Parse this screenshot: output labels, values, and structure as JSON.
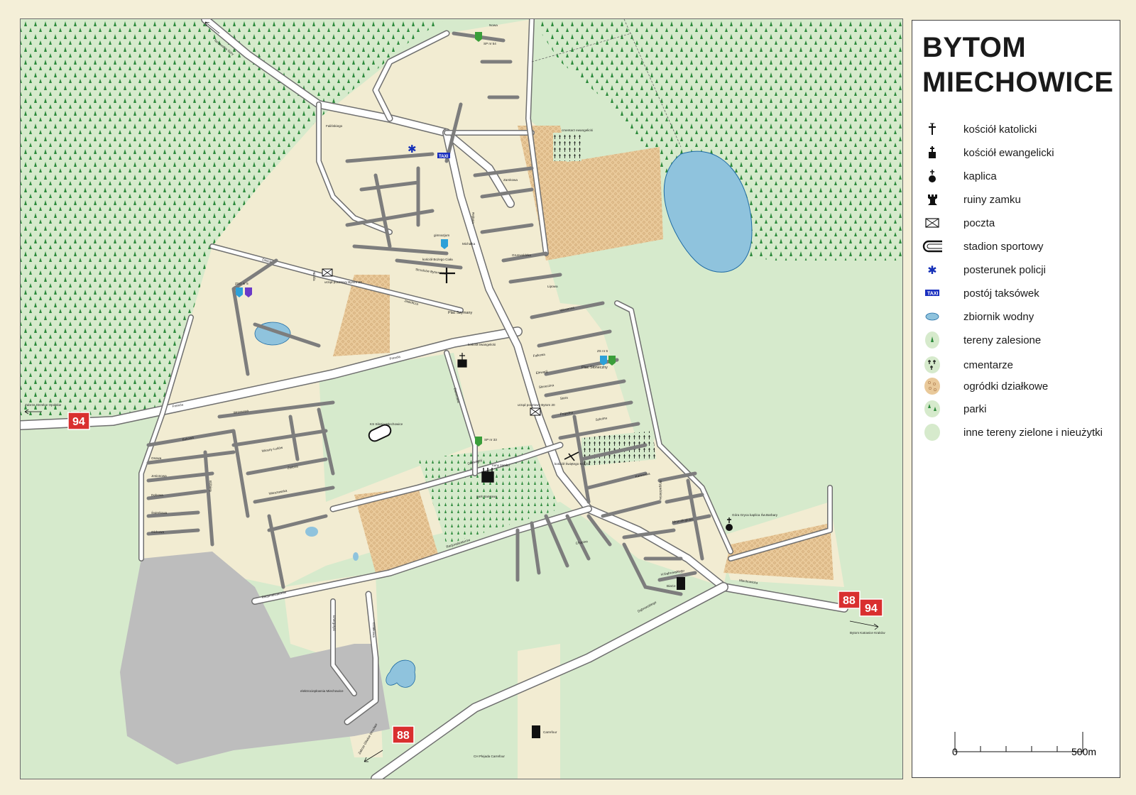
{
  "legend": {
    "title_line1": "BYTOM",
    "title_line2": "MIECHOWICE",
    "items": [
      {
        "label": "kościół katolicki",
        "icon": "latin-cross-icon"
      },
      {
        "label": "kościół ewangelicki",
        "icon": "evangelical-church-icon"
      },
      {
        "label": "kaplica",
        "icon": "chapel-icon"
      },
      {
        "label": "ruiny zamku",
        "icon": "castle-ruin-icon"
      },
      {
        "label": "poczta",
        "icon": "envelope-icon"
      },
      {
        "label": "stadion sportowy",
        "icon": "stadium-icon"
      },
      {
        "label": "posterunek policji",
        "icon": "police-star-icon"
      },
      {
        "label": "postój taksówek",
        "icon": "taxi-icon"
      },
      {
        "label": "zbiornik wodny",
        "icon": "water-body-icon"
      },
      {
        "label": "tereny zalesione",
        "icon": "forest-icon"
      },
      {
        "label": "cmentarze",
        "icon": "cemetery-icon"
      },
      {
        "label": "ogródki działkowe",
        "icon": "allotment-gardens-icon"
      },
      {
        "label": "parki",
        "icon": "park-icon"
      },
      {
        "label": "inne tereny zielone i nieużytki",
        "icon": "green-area-icon"
      }
    ],
    "scale": {
      "start": "0",
      "end": "500m"
    }
  },
  "colors": {
    "forest": "#d6eacc",
    "tree": "#2d8a3c",
    "built_up": "#f2ecd2",
    "road": "#ffffff",
    "road_outline": "#6f6f6f",
    "water": "#8fc3dd",
    "water_outline": "#1e6aa3",
    "allotment": "#e9c99a",
    "industrial": "#bdbdbd",
    "route_shield": "#d92f2f",
    "taxi": "#1a2fbf",
    "police": "#1530b8"
  },
  "map": {
    "route_shields": [
      "94",
      "94",
      "88",
      "88"
    ],
    "taxi_text": "TAXI",
    "places": {
      "plac_szymany": "Plac Szymany",
      "plac_sloneczny": "Plac Słoneczny",
      "ks_silesia": "KS Silesia Miechowice",
      "park": "park Sansowy",
      "gora_gryca": "Góra Gryca kaplica Św.Barbary",
      "elektrocieplownia": "elektrociepłownia Miechowice",
      "ch_plejada": "CH Plejada Carrefour",
      "carrefour": "Carrefour",
      "biedronka": "BiaCe",
      "cmentarz_ewang": "cmentarz ewangelicki",
      "gimnazjum": "gimnazjum",
      "zso": "ZSO nr 5",
      "sp54": "SP nr 54",
      "sp33": "SP nr 33",
      "zs6": "ZS nr 6",
      "kosciol_bozego": "kościół Bożego Ciała",
      "kosciol_ewang": "kościół ewangelicki",
      "kosciol_krzyza": "kościół Świętego Krzyża",
      "urzad1": "urząd pocztowy Bytom 23",
      "urzad2": "urząd pocztowy Bytom 20",
      "ruin": "ruiny zamku"
    },
    "directions": {
      "nw": "Tarnowskie Góry",
      "w": "Zabrze Strzelce Opolskie",
      "se": "Bytom Katowice Kraków",
      "s": "Zabrze Gliwice Wrocław"
    },
    "streets": {
      "fenicka": "Frencla",
      "frencla2": "Frencla",
      "dzialkowa": "Dziewiątej",
      "stolarska": "Stolarzowicka",
      "nowa": "Nowa",
      "miechowicka": "Miechowicka",
      "dabrowskiego": "Dąbrowskiego",
      "rycerska": "Racjonalizatorów",
      "michalka": "Michalka",
      "fabryczna": "Falińskiego",
      "strzelcow": "Strzelców Bytomskich",
      "elzbiety": "Elżbiety",
      "nickla": "Nickla",
      "dasza": "Dasza",
      "jaskolcza": "Jaskółcza",
      "zamkowa": "Zamkowa",
      "wiosenna": "Wiosenna",
      "lipowa": "Lipowa",
      "grunwaldzka": "Grunwaldzka",
      "energetyki": "Energetyki",
      "dzialkowa2": "Działkowa",
      "krzywa": "Kręta",
      "chopina": "Chopina",
      "sikorskiego": "Sikorskiego",
      "wozniaka": "Woźniaka",
      "jesionowa": "Jesionowa",
      "debowa": "Dębowa",
      "swierkowa": "Świerkowa",
      "olchowa": "Olchowa",
      "osowa": "Osowa",
      "bukowa": "Bukowa",
      "wrzosowa": "Wrzosowa",
      "zielona": "Zielona",
      "wiosny": "Wiosny Ludów",
      "warszawska": "Warszawska",
      "dzika": "Dzika",
      "falkowa": "Falkowa",
      "elewacji": "Elewacji",
      "sloneczna": "Słoneczna",
      "pogodna": "Pogodna",
      "stara": "Stara",
      "karlowska": "Karłowska",
      "brygadzistow": "Brygadzistów",
      "dolna": "Dolna",
      "niepodleglosci": "Niepodległości",
      "karwinska": "Kamińska",
      "wieczorka": "Wieczorka",
      "brzezinska": "Brzezińska",
      "stawowa": "Stawowa",
      "barlickiego": "Barlickiego",
      "szymanowskiego": "Szymanowskiego",
      "zwyciestwa": "Zwycięstwa",
      "dabrowskiego2": "H.Dąbrowskiego",
      "wyzwolenia": "Wyzwolenia",
      "rolnicza": "Rolnicza",
      "swietojanska": "Świętojańska",
      "dlugosza": "Długosza",
      "skrzata": "Skrzatów",
      "nowa2": "Nowa",
      "wiejska": "Wiejska",
      "kasztanowa": "Kasztanowa",
      "zrodlana": "Źródlana",
      "polna": "Polna",
      "mieszka": "Mieszka",
      "szkolna": "Szkolna",
      "rejtana": "Rejtana",
      "dworcowa": "Dworcowa"
    }
  }
}
